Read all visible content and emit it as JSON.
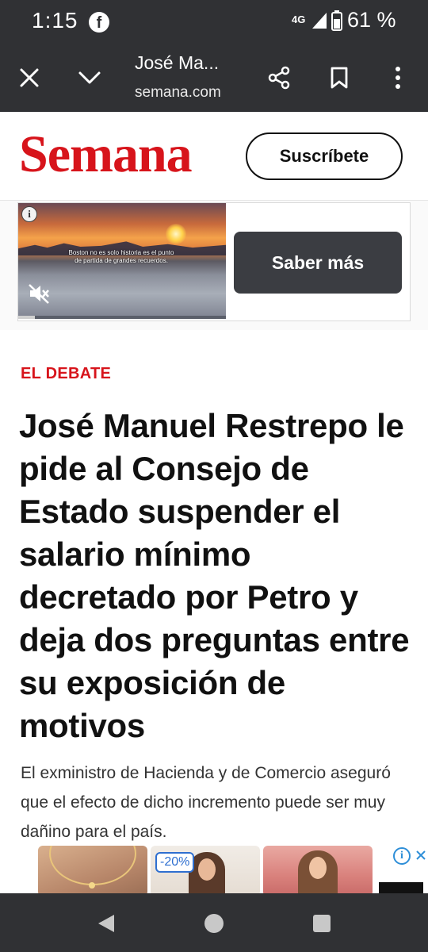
{
  "status_bar": {
    "time": "1:15",
    "network": "4G",
    "battery": "61 %",
    "notification_icon": "facebook-icon"
  },
  "browser": {
    "title": "José Ma...",
    "url": "semana.com",
    "icons": [
      "close-icon",
      "chevron-down-icon",
      "share-icon",
      "bookmark-icon",
      "more-vert-icon"
    ]
  },
  "site": {
    "logo_text": "Semana",
    "subscribe_label": "Suscríbete",
    "brand_color": "#d7141b"
  },
  "ad": {
    "overlay_text": "Boston no es solo historia es el punto de partida de grandes recuerdos.",
    "cta_label": "Saber más",
    "video_progress": 0.08
  },
  "article": {
    "section": "EL DEBATE",
    "headline": "José Manuel Restrepo le pide al Consejo de Estado suspender el salario mínimo decretado por Petro y deja dos preguntas entre su exposición de motivos",
    "summary": "El exministro de Hacienda y de Comercio aseguró que el efecto de dicho incremento puede ser muy dañino para el país."
  },
  "bottom_ad": {
    "discount": "-20%"
  },
  "nav_bar": {
    "icons": [
      "back-icon",
      "home-icon",
      "recents-icon"
    ]
  }
}
